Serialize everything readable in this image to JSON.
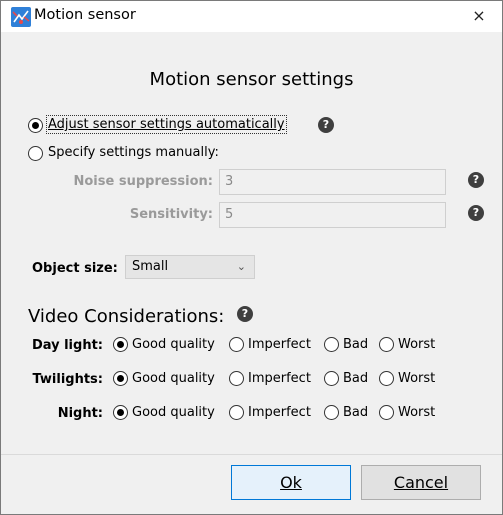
{
  "window": {
    "title": "Motion sensor",
    "close_glyph": "×"
  },
  "heading": "Motion sensor settings",
  "mode": {
    "auto_label": "Adjust sensor settings automatically",
    "manual_label": "Specify settings manually:",
    "selected": "auto"
  },
  "manual": {
    "noise_label": "Noise suppression:",
    "noise_value": "3",
    "sensitivity_label": "Sensitivity:",
    "sensitivity_value": "5"
  },
  "object_size": {
    "label": "Object size:",
    "value": "Small"
  },
  "video": {
    "heading": "Video Considerations:",
    "options": [
      "Good quality",
      "Imperfect",
      "Bad",
      "Worst"
    ],
    "rows": [
      {
        "label": "Day light:",
        "selected": "Good quality"
      },
      {
        "label": "Twilights:",
        "selected": "Good quality"
      },
      {
        "label": "Night:",
        "selected": "Good quality"
      }
    ]
  },
  "buttons": {
    "ok": "Ok",
    "cancel": "Cancel"
  },
  "help_glyph": "?",
  "chevron_glyph": "⌄",
  "colors": {
    "accent": "#0078d7",
    "help_icon": "#3f3f3f",
    "disabled_text": "#9a9a9a"
  }
}
